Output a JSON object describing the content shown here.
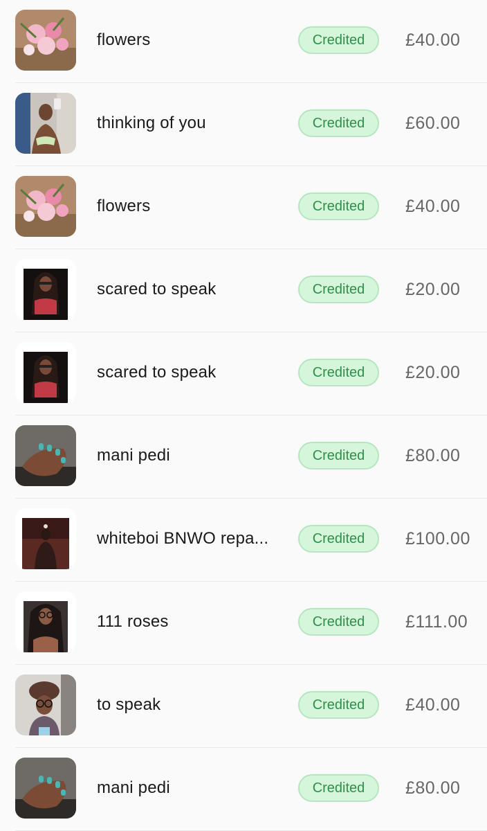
{
  "transactions": [
    {
      "title": "flowers",
      "status": "Credited",
      "amount": "£40.00",
      "thumbnail_icon": "flower-bouquet-photo"
    },
    {
      "title": "thinking of you",
      "status": "Credited",
      "amount": "£60.00",
      "thumbnail_icon": "mirror-selfie-photo"
    },
    {
      "title": "flowers",
      "status": "Credited",
      "amount": "£40.00",
      "thumbnail_icon": "flower-bouquet-photo"
    },
    {
      "title": "scared to speak",
      "status": "Credited",
      "amount": "£20.00",
      "thumbnail_icon": "portrait-photo"
    },
    {
      "title": "scared to speak",
      "status": "Credited",
      "amount": "£20.00",
      "thumbnail_icon": "portrait-photo"
    },
    {
      "title": "mani pedi",
      "status": "Credited",
      "amount": "£80.00",
      "thumbnail_icon": "manicure-photo"
    },
    {
      "title": "whiteboi BNWO repa...",
      "status": "Credited",
      "amount": "£100.00",
      "thumbnail_icon": "artwork-photo"
    },
    {
      "title": "111 roses",
      "status": "Credited",
      "amount": "£111.00",
      "thumbnail_icon": "portrait-photo"
    },
    {
      "title": "to speak",
      "status": "Credited",
      "amount": "£40.00",
      "thumbnail_icon": "selfie-photo"
    },
    {
      "title": "mani pedi",
      "status": "Credited",
      "amount": "£80.00",
      "thumbnail_icon": "manicure-photo"
    }
  ],
  "colors": {
    "badge_bg": "#d6f6dc",
    "badge_border": "#b5e6bf",
    "badge_text": "#2f8f48",
    "amount_text": "#666666",
    "title_text": "#1a1a1a"
  }
}
